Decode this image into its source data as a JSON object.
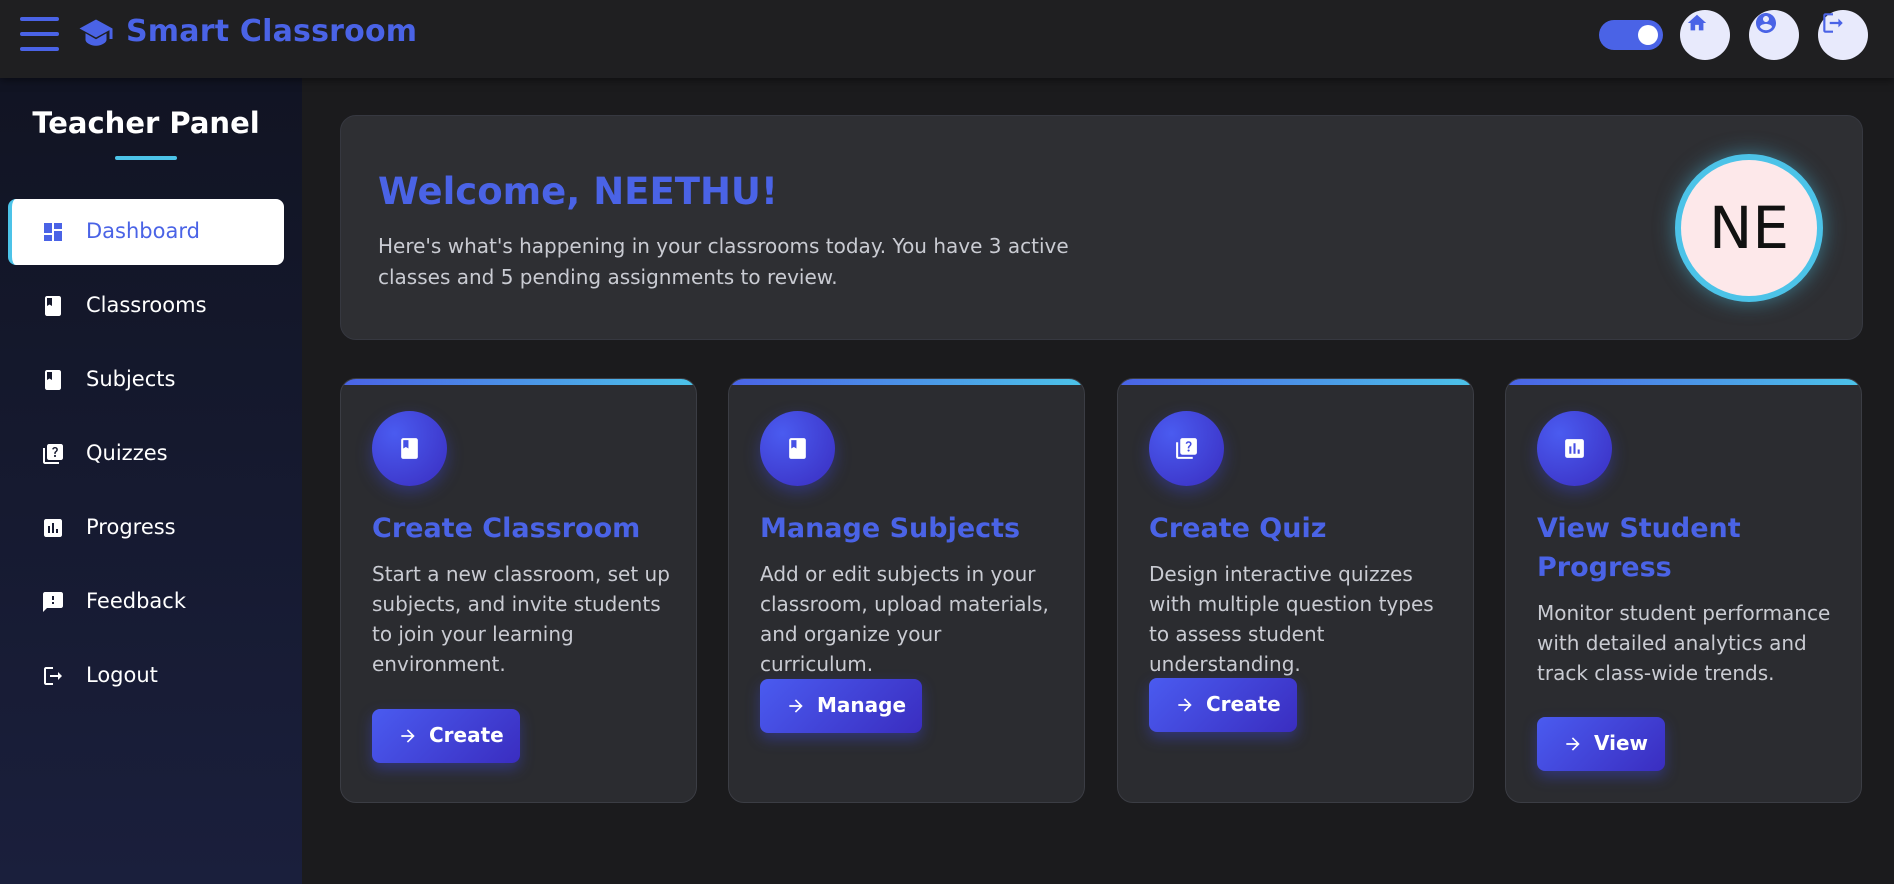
{
  "app": {
    "title": "Smart Classroom",
    "accent_color": "#4a63e6",
    "secondary_color": "#4cc3e8"
  },
  "topbar": {
    "menu_icon": "hamburger-menu-icon",
    "brand_icon": "graduation-cap-icon",
    "theme_toggle_on": true,
    "actions": [
      {
        "name": "home",
        "icon": "home-icon"
      },
      {
        "name": "profile",
        "icon": "account-circle-icon"
      },
      {
        "name": "logout",
        "icon": "logout-icon"
      }
    ]
  },
  "sidebar": {
    "title": "Teacher Panel",
    "items": [
      {
        "label": "Dashboard",
        "icon": "dashboard-icon",
        "active": true
      },
      {
        "label": "Classrooms",
        "icon": "book-icon",
        "active": false
      },
      {
        "label": "Subjects",
        "icon": "book-icon",
        "active": false
      },
      {
        "label": "Quizzes",
        "icon": "quiz-icon",
        "active": false
      },
      {
        "label": "Progress",
        "icon": "bar-chart-icon",
        "active": false
      },
      {
        "label": "Feedback",
        "icon": "feedback-icon",
        "active": false
      },
      {
        "label": "Logout",
        "icon": "logout-icon",
        "active": false
      }
    ]
  },
  "welcome": {
    "title": "Welcome, NEETHU!",
    "text": "Here's what's happening in your classrooms today. You have 3 active classes and 5 pending assignments to review.",
    "avatar_initials": "NE"
  },
  "cards": [
    {
      "title": "Create Classroom",
      "icon": "book-icon",
      "text": "Start a new classroom, set up subjects, and invite students to join your learning environment.",
      "button": "Create"
    },
    {
      "title": "Manage Subjects",
      "icon": "book-icon",
      "text": "Add or edit subjects in your classroom, upload materials, and organize your curriculum.",
      "button": "Manage"
    },
    {
      "title": "Create Quiz",
      "icon": "quiz-icon",
      "text": "Design interactive quizzes with multiple question types to assess student understanding.",
      "button": "Create"
    },
    {
      "title": "View Student Progress",
      "icon": "bar-chart-icon",
      "text": "Monitor student performance with detailed analytics and track class-wide trends.",
      "button": "View"
    }
  ]
}
